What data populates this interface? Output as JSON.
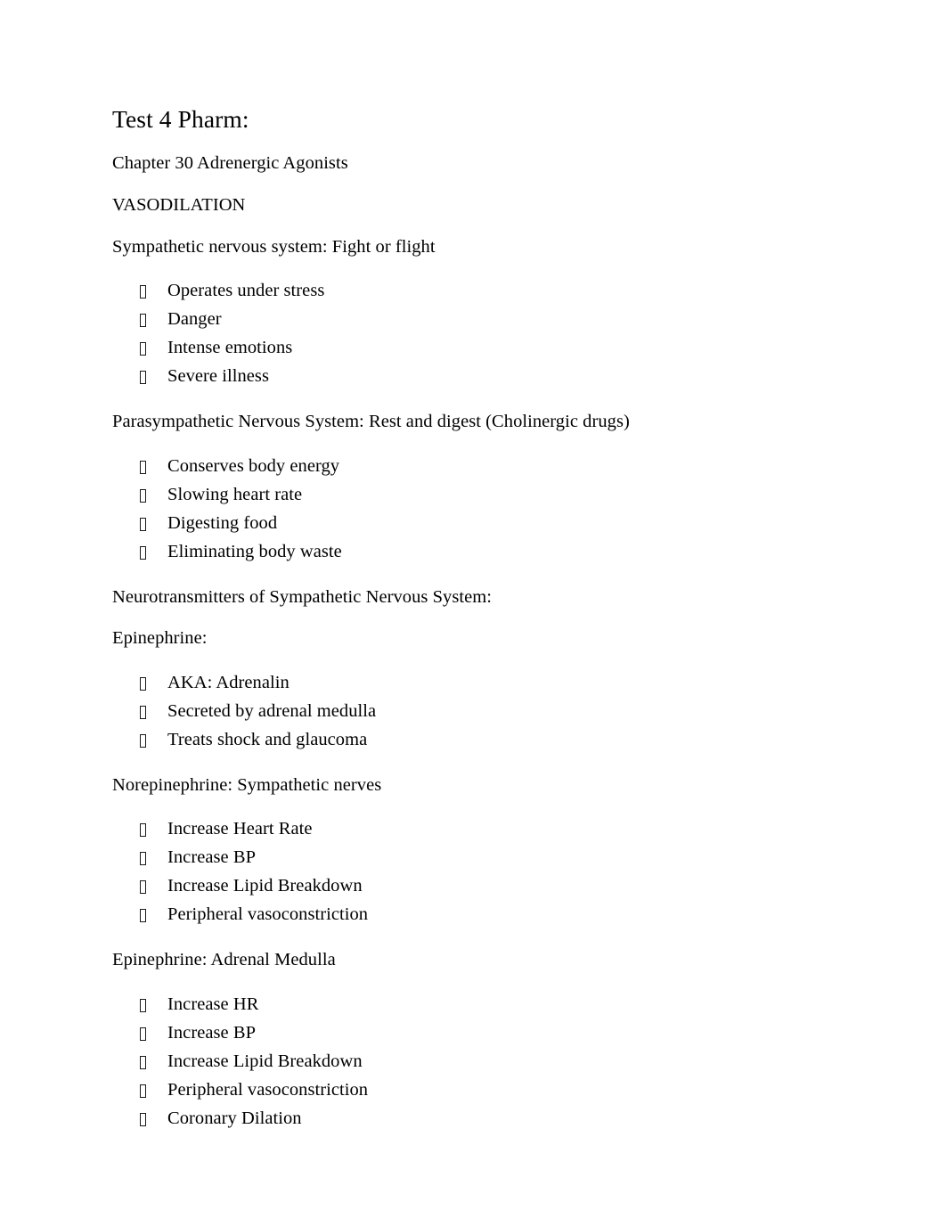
{
  "document": {
    "title": "Test 4 Pharm:",
    "bullet_marker": "missing-glyph-box",
    "text_color": "#000000",
    "background_color": "#ffffff",
    "blocks": [
      {
        "type": "paragraph",
        "text": "Chapter 30 Adrenergic Agonists"
      },
      {
        "type": "paragraph",
        "text": "VASODILATION"
      },
      {
        "type": "paragraph",
        "text": "Sympathetic nervous system: Fight or flight"
      },
      {
        "type": "list",
        "items": [
          "Operates under stress",
          "Danger",
          "Intense emotions",
          "Severe illness"
        ]
      },
      {
        "type": "paragraph",
        "text": "Parasympathetic Nervous System: Rest and digest (Cholinergic drugs)"
      },
      {
        "type": "list",
        "items": [
          "Conserves body energy",
          "Slowing heart rate",
          "Digesting food",
          "Eliminating body waste"
        ]
      },
      {
        "type": "paragraph",
        "text": "Neurotransmitters of Sympathetic Nervous System:"
      },
      {
        "type": "paragraph",
        "text": "Epinephrine:"
      },
      {
        "type": "list",
        "items": [
          "AKA: Adrenalin",
          "Secreted by adrenal medulla",
          "Treats shock and glaucoma"
        ]
      },
      {
        "type": "paragraph",
        "text": "Norepinephrine: Sympathetic nerves"
      },
      {
        "type": "list",
        "items": [
          "Increase Heart Rate",
          "Increase BP",
          "Increase Lipid Breakdown",
          "Peripheral vasoconstriction"
        ]
      },
      {
        "type": "paragraph",
        "text": "Epinephrine: Adrenal Medulla"
      },
      {
        "type": "list",
        "items": [
          "Increase HR",
          "Increase BP",
          "Increase Lipid Breakdown",
          "Peripheral vasoconstriction",
          "Coronary Dilation"
        ]
      }
    ]
  }
}
